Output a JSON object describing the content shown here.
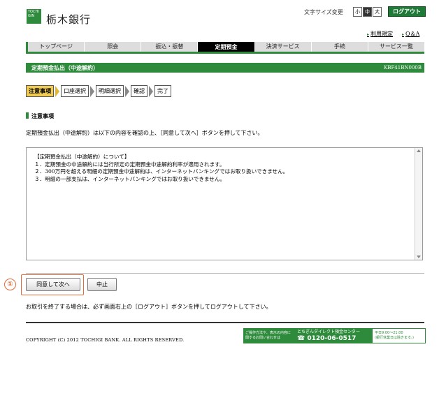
{
  "header": {
    "logo_mark": "TOCHI GIN",
    "bank_name": "栃木銀行",
    "font_size_label": "文字サイズ変更",
    "font_sizes": [
      "小",
      "中",
      "大"
    ],
    "active_font_size": "中",
    "logout_label": "ログアウト",
    "links": [
      "利用規定",
      "Q＆A"
    ]
  },
  "nav": {
    "items": [
      "トップページ",
      "照会",
      "振込・振替",
      "定期預金",
      "決済サービス",
      "手続",
      "サービス一覧"
    ],
    "active": "定期預金"
  },
  "section": {
    "title": "定期預金払出（中途解約）",
    "code": "KBF41BN000B"
  },
  "steps": [
    "注意事項",
    "口座選択",
    "明細選択",
    "確認",
    "完了"
  ],
  "current_step": "注意事項",
  "content": {
    "heading": "注意事項",
    "instruction": "定期預金払出（中途解約）は以下の内容を確認の上、［同意して次へ］ボタンを押して下さい。",
    "terms_title": "【定期預金払出（中途解約）について】",
    "terms_items": [
      "１．定期預金の中途解約には当行所定の定期預金中途解約利率が適用されます。",
      "２．300万円を超える明細の定期預金中途解約は、インターネットバンキングではお取り扱いできません。",
      "３．明細の一部支払は、インターネットバンキングではお取り扱いできません。"
    ]
  },
  "buttons": {
    "agree_label": "同意して次へ",
    "cancel_label": "中止"
  },
  "annotation": "①",
  "notice": "お取引を終了する場合は、必ず画面右上の［ログアウト］ボタンを押してログアウトして下さい。",
  "footer": {
    "copyright": "COPYRIGHT (C) 2012 TOCHIGI BANK. ALL RIGHTS RESERVED.",
    "contact_left_1": "ご操作方法や、表示の内容に",
    "contact_left_2": "関するお問い合わせは",
    "contact_center": "とちぎんダイレクト預金センター",
    "contact_phone": "0120-06-0517",
    "contact_hours_1": "平日9:00〜21:00",
    "contact_hours_2": "(銀行休業日は除きます。)"
  },
  "colors": {
    "brand_green": "#2e8b3c",
    "current_step": "#f1cc55",
    "annotation": "#e06a3a"
  }
}
